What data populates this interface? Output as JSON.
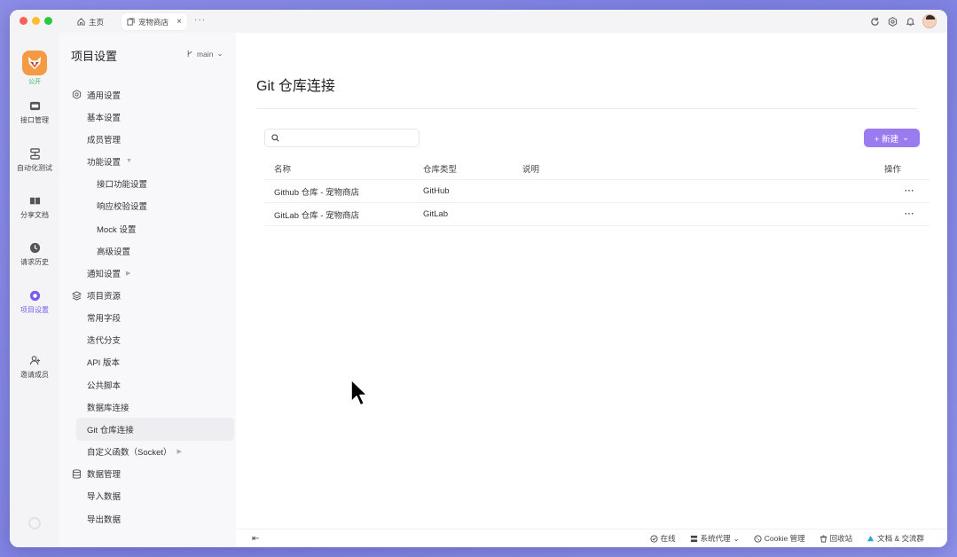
{
  "titlebar": {
    "tabs": [
      {
        "label": "主页",
        "icon": "home-icon"
      },
      {
        "label": "宠物商店",
        "icon": "project-icon",
        "active": true
      }
    ],
    "more": "···",
    "right_icons": [
      "sync-icon",
      "settings-icon",
      "bell-icon",
      "avatar"
    ]
  },
  "rail": {
    "logo_tag": "公开",
    "items": [
      {
        "label": "接口管理",
        "icon": "api-icon"
      },
      {
        "label": "自动化测试",
        "icon": "automation-icon"
      },
      {
        "label": "分享文档",
        "icon": "book-icon"
      },
      {
        "label": "请求历史",
        "icon": "history-icon"
      },
      {
        "label": "项目设置",
        "icon": "settings-icon",
        "active": true
      },
      {
        "label": "邀请成员",
        "icon": "add-user-icon"
      }
    ],
    "accent": "#7b5ce6"
  },
  "panel": {
    "title": "项目设置",
    "branch": "main",
    "groups": [
      {
        "label": "通用设置",
        "icon": "gear-icon"
      },
      {
        "label": "项目资源",
        "icon": "layers-icon"
      },
      {
        "label": "数据管理",
        "icon": "database-icon"
      }
    ],
    "items": {
      "basic": "基本设置",
      "members": "成员管理",
      "features": "功能设置",
      "api_features": "接口功能设置",
      "response_validation": "响应校验设置",
      "mock": "Mock 设置",
      "advanced": "高级设置",
      "notifications": "通知设置",
      "common_fields": "常用字段",
      "iteration_branch": "迭代分支",
      "api_version": "API 版本",
      "public_scripts": "公共脚本",
      "db_connection": "数据库连接",
      "git_connection": "Git 仓库连接",
      "custom_functions": "自定义函数（Socket）",
      "import": "导入数据",
      "export": "导出数据"
    }
  },
  "main": {
    "title": "Git 仓库连接",
    "search_placeholder": "",
    "new_button": "+ 新建",
    "columns": [
      "名称",
      "仓库类型",
      "说明",
      "操作"
    ],
    "rows": [
      {
        "name": "Github 仓库 - 宠物商店",
        "type": "GitHub",
        "desc": "",
        "ops": "···"
      },
      {
        "name": "GitLab 仓库 - 宠物商店",
        "type": "GitLab",
        "desc": "",
        "ops": "···"
      }
    ],
    "button_color": "#9b7cf0"
  },
  "statusbar": {
    "items": [
      {
        "label": "在线",
        "icon": "online-icon"
      },
      {
        "label": "系统代理",
        "icon": "proxy-icon"
      },
      {
        "label": "Cookie 管理",
        "icon": "cookie-icon"
      },
      {
        "label": "回收站",
        "icon": "trash-icon"
      },
      {
        "label": "文档 & 交流群",
        "icon": "docs-icon"
      }
    ]
  }
}
